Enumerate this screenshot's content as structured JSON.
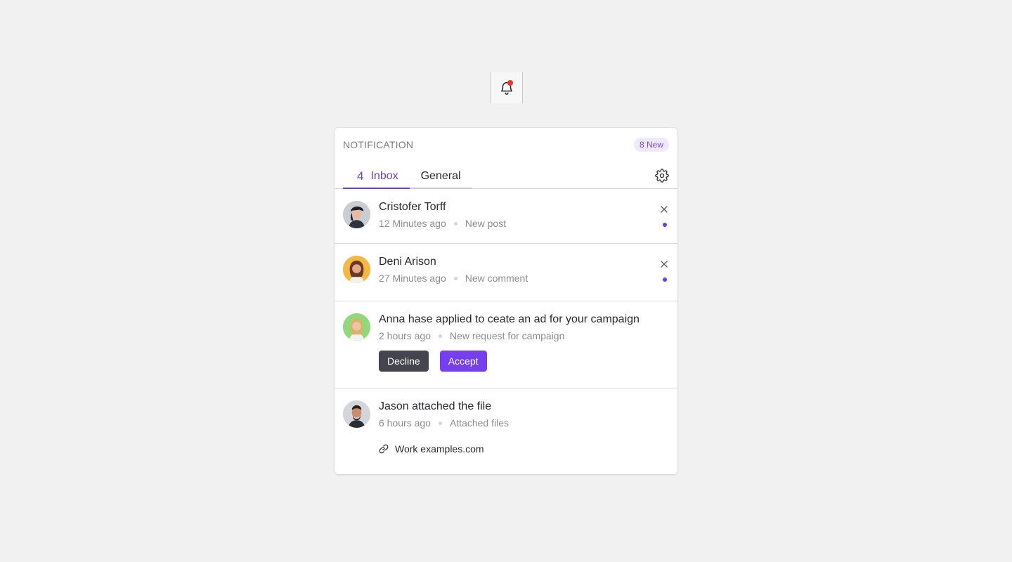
{
  "bell": {
    "icon": "bell-icon",
    "has_unread": true,
    "dot_color": "#f0322c"
  },
  "panel": {
    "title": "NOTIFICATION",
    "new_badge": "8 New",
    "tabs": [
      {
        "count": "4",
        "label": "Inbox",
        "active": true
      },
      {
        "label": "General",
        "active": false
      }
    ],
    "settings_icon": "gear-icon"
  },
  "notifications": [
    {
      "title": "Cristofer Torff",
      "time": "12 Minutes ago",
      "type": "New post",
      "unread": true,
      "avatar_bg": "#c9ccd3"
    },
    {
      "title": "Deni Arison",
      "time": "27 Minutes ago",
      "type": "New comment",
      "unread": true,
      "avatar_bg": "#f5b843"
    },
    {
      "title": "Anna hase applied to ceate an ad for your campaign",
      "time": "2 hours ago",
      "type": "New request for campaign",
      "unread": false,
      "avatar_bg": "#8fd97a",
      "actions": {
        "decline": "Decline",
        "accept": "Accept"
      }
    },
    {
      "title": "Jason attached the file",
      "time": "6 hours ago",
      "type": "Attached files",
      "unread": false,
      "avatar_bg": "#d3d5db",
      "link": {
        "icon": "link-icon",
        "label": "Work examples.com"
      }
    }
  ],
  "colors": {
    "accent": "#6d3ee8",
    "accept": "#7540ec",
    "decline": "#45454f",
    "background": "#f1f1f1"
  }
}
